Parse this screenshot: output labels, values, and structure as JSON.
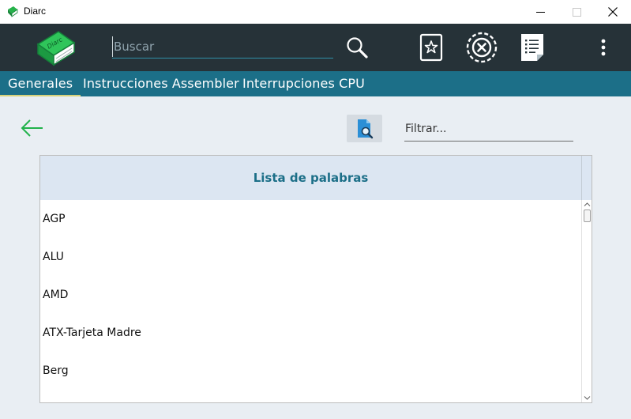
{
  "window": {
    "title": "Diarc",
    "controls": [
      "minimize-icon",
      "maximize-icon",
      "close-icon"
    ]
  },
  "toolbar": {
    "logo_text": "Diarc",
    "search": {
      "placeholder": "Buscar",
      "value": ""
    },
    "icons": [
      "search-icon",
      "bookmark-star-icon",
      "cancel-circle-icon",
      "list-document-icon",
      "more-vert-icon"
    ]
  },
  "tabs": [
    {
      "label": "Generales",
      "active": true
    },
    {
      "label": "Instrucciones Assembler",
      "active": false
    },
    {
      "label": "Interrupciones CPU",
      "active": false
    }
  ],
  "content": {
    "back_icon": "arrow-left-icon",
    "search_document_icon": "document-search-icon",
    "filter": {
      "placeholder": "Filtrar...",
      "value": ""
    },
    "list": {
      "header": "Lista de palabras",
      "items": [
        "AGP",
        "ALU",
        "AMD",
        "ATX-Tarjeta Madre",
        "Berg"
      ]
    }
  },
  "colors": {
    "toolbar_bg": "#263238",
    "tabs_bg": "#1c6f88",
    "accent_green": "#21b24b",
    "header_text": "#1c6f88",
    "tab_underline": "#d8d27a"
  }
}
